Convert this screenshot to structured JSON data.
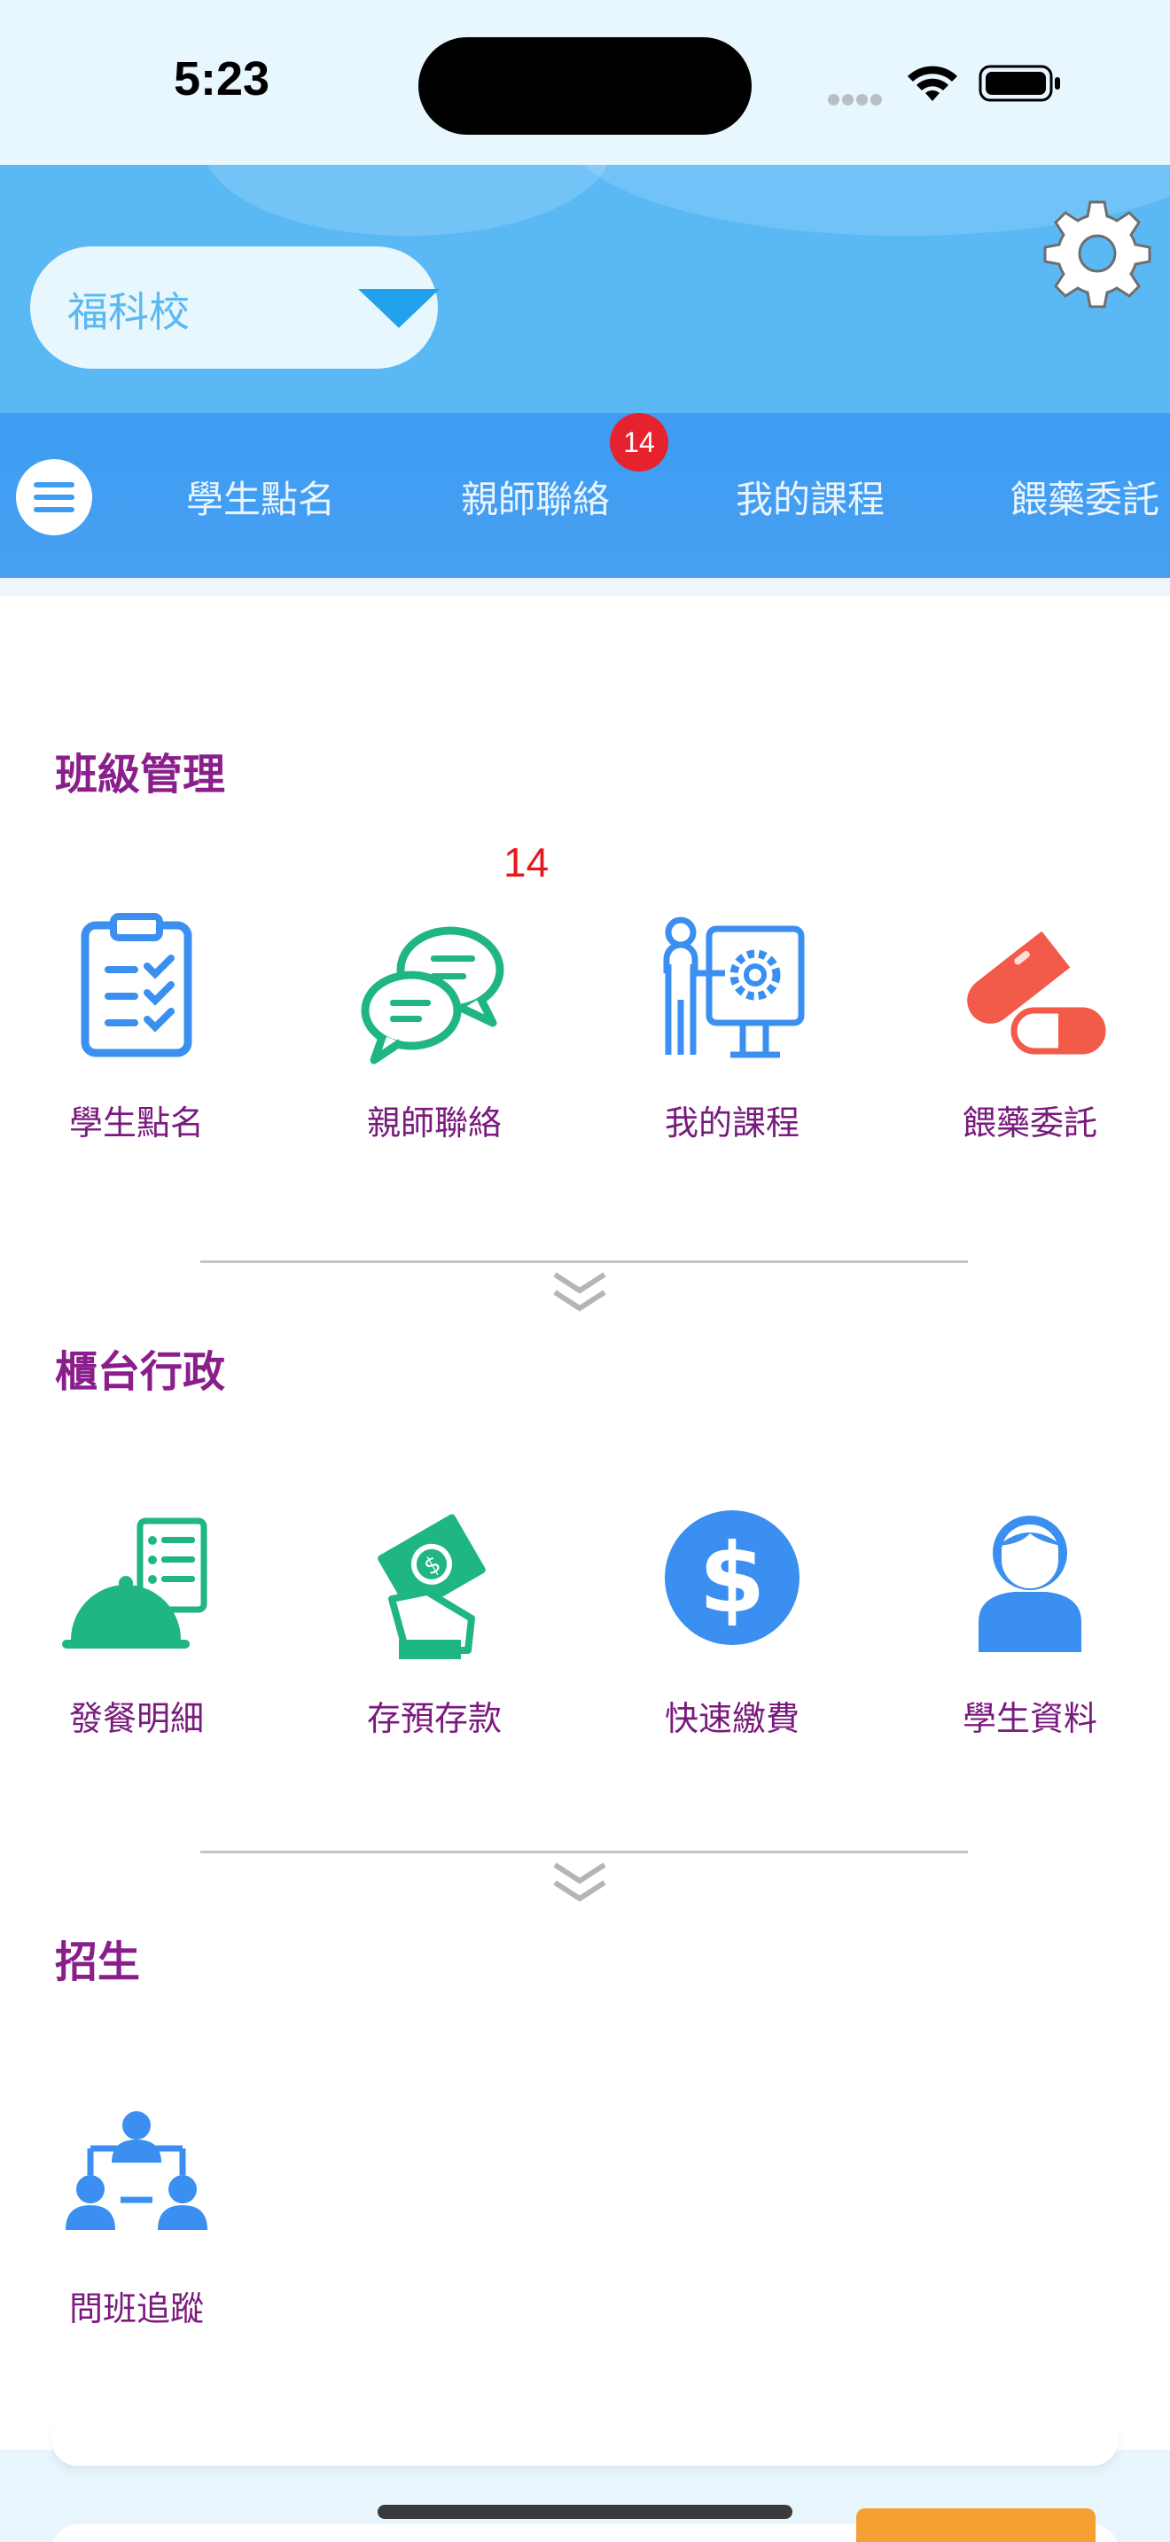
{
  "status_bar": {
    "time": "5:23"
  },
  "header": {
    "school_select_value": "福科校"
  },
  "nav": {
    "tabs": [
      {
        "label": "學生點名"
      },
      {
        "label": "親師聯絡",
        "badge": "14"
      },
      {
        "label": "我的課程"
      },
      {
        "label": "餵藥委託"
      }
    ]
  },
  "sections": [
    {
      "title": "班級管理",
      "items": [
        {
          "label": "學生點名",
          "icon": "clipboard-checklist-icon"
        },
        {
          "label": "親師聯絡",
          "icon": "chat-bubbles-icon",
          "badge": "14"
        },
        {
          "label": "我的課程",
          "icon": "teacher-presentation-icon"
        },
        {
          "label": "餵藥委託",
          "icon": "medicine-capsule-icon"
        }
      ]
    },
    {
      "title": "櫃台行政",
      "items": [
        {
          "label": "發餐明細",
          "icon": "meal-cloche-list-icon"
        },
        {
          "label": "存預存款",
          "icon": "money-hand-icon"
        },
        {
          "label": "快速繳費",
          "icon": "dollar-coin-icon"
        },
        {
          "label": "學生資料",
          "icon": "student-profile-icon"
        }
      ]
    },
    {
      "title": "招生",
      "items": [
        {
          "label": "問班追蹤",
          "icon": "org-chart-people-icon"
        }
      ]
    }
  ],
  "colors": {
    "header_blue": "#5ab8f5",
    "nav_blue": "#3d9df3",
    "title_purple": "#8a1f8c",
    "label_purple": "#7a1a7e",
    "badge_red": "#e6222f",
    "icon_blue": "#3b8ff0",
    "icon_green": "#20b585",
    "icon_red": "#f25a4a",
    "accent_orange": "#f5a033"
  }
}
